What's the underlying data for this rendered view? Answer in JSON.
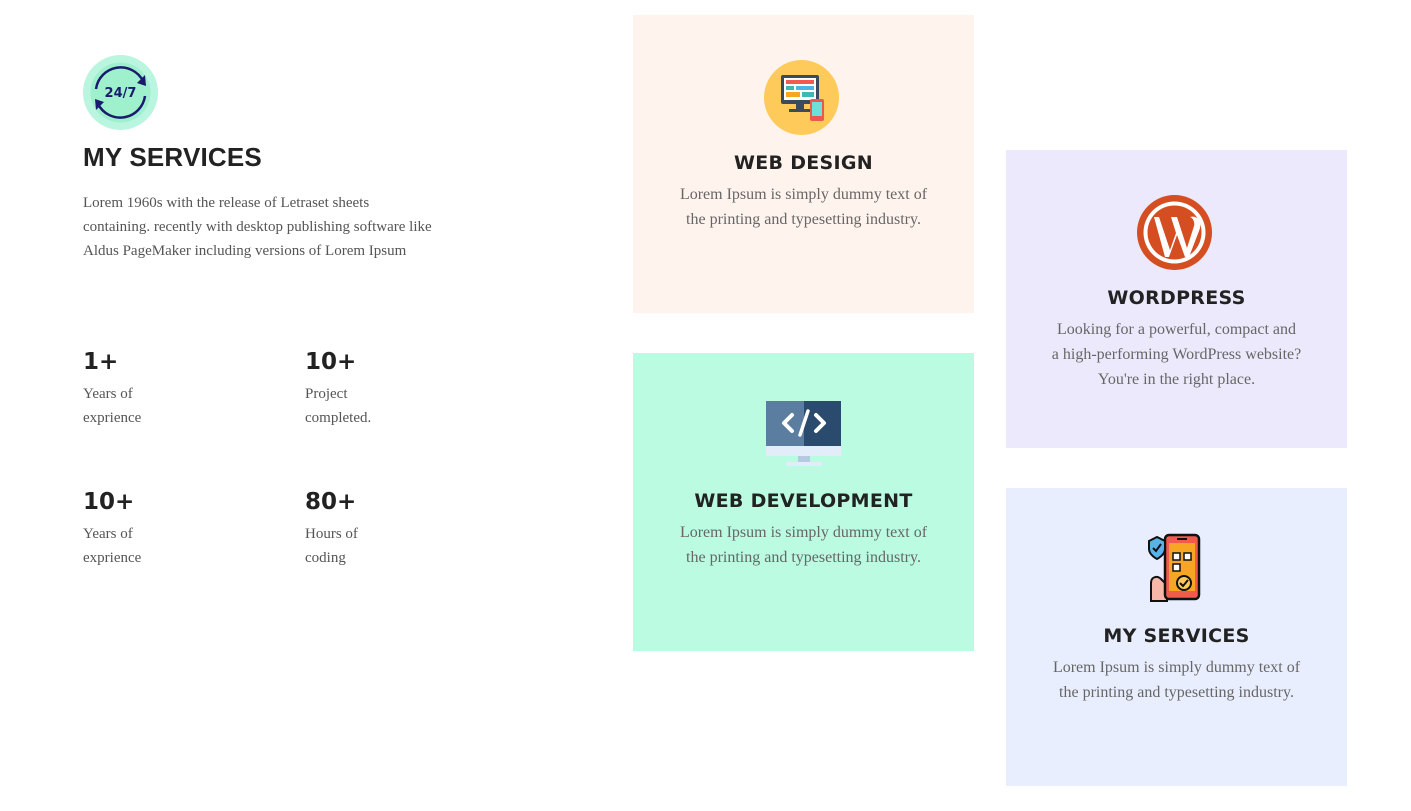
{
  "intro": {
    "badge_text": "24/7",
    "title": "MY SERVICES",
    "description": "Lorem 1960s with the release of Letraset sheets containing. recently with desktop publishing software like Aldus PageMaker including versions of Lorem Ipsum"
  },
  "stats": [
    {
      "value": "1+",
      "label": "Years of exprience"
    },
    {
      "value": "10+",
      "label": "Project completed."
    },
    {
      "value": "10+",
      "label": "Years of exprience"
    },
    {
      "value": "80+",
      "label": "Hours of coding"
    }
  ],
  "cards": [
    {
      "title": "WEB DESIGN",
      "text": "Lorem Ipsum is simply dummy text of the printing and typesetting industry.",
      "icon": "web-design-icon",
      "bg": "#fff3ee"
    },
    {
      "title": "WEB DEVELOPMENT",
      "text": "Lorem Ipsum is simply dummy text of the printing and typesetting industry.",
      "icon": "code-monitor-icon",
      "bg": "#bbfbe1"
    },
    {
      "title": "WORDPRESS",
      "text": "Looking for a powerful, compact and a high-performing WordPress website? You're in the right place.",
      "icon": "wordpress-icon",
      "bg": "#ece9fc"
    },
    {
      "title": "MY SERVICES",
      "text": "Lorem Ipsum is simply dummy text of the printing and typesetting industry.",
      "icon": "mobile-security-icon",
      "bg": "#e8eefd"
    }
  ]
}
